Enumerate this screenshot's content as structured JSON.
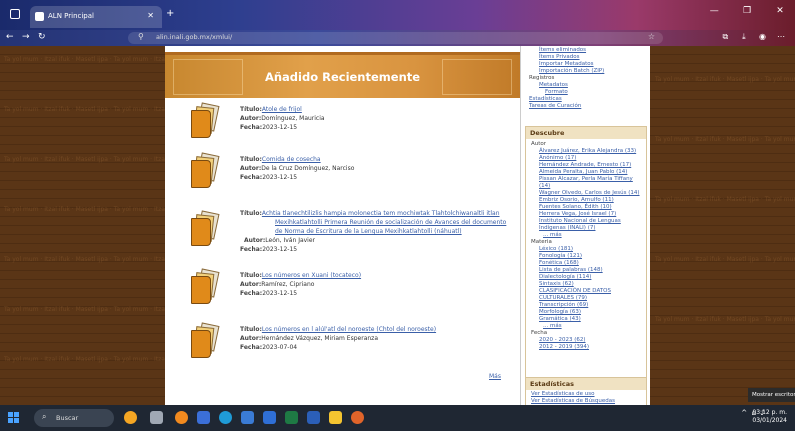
{
  "browser": {
    "tab_title": "ALN Principal",
    "tab_close": "✕",
    "new_tab": "+",
    "url": "alin.inali.gob.mx/xmlui/",
    "window": {
      "minimize": "—",
      "restore": "❐",
      "close": "✕"
    }
  },
  "page": {
    "banner_title": "Añadido Recientemente",
    "labels": {
      "title": "Título:",
      "author": "Autor:",
      "date": "Fecha:"
    },
    "records": [
      {
        "title": "Atole de frijol",
        "author": "Domínguez, Mauricia",
        "date": "2023-12-15"
      },
      {
        "title": "Comida de cosecha",
        "author": "De la Cruz Domínguez, Narciso",
        "date": "2023-12-15"
      },
      {
        "title_lines": [
          "Achtia tlanechtilizlis hampia molonectia tem mochiwtak Tlahtolchiwanaltli itlan",
          "Mexihkatlahtolli Primera Reunión de socialización de Avances del documento",
          "de Norma de Escritura de la Lengua Mexihkatlahtolli (náhuatl)"
        ],
        "author": "León, Iván Javier",
        "date": "2023-12-15"
      },
      {
        "title": "Los números en Xuani (tocateco)",
        "author": "Ramírez, Cipriano",
        "date": "2023-12-15"
      },
      {
        "title": "Los números en l alúl'atl del noroeste (Chtol del noroeste)",
        "author": "Hernández Vázquez, Miriam Esperanza",
        "date": "2023-07-04"
      }
    ],
    "more_link": "Más"
  },
  "sidebar": {
    "admin_links": [
      "Ítems eliminados",
      "Ítems Privados",
      "Importar Metadatos",
      "Importación Batch (ZIP)"
    ],
    "registros_label": "Registros",
    "registros_links": [
      "Metadatos",
      "Formato"
    ],
    "other_links": [
      "Estadísticas",
      "Tareas de Curación"
    ],
    "descubre": {
      "title": "Descubre",
      "autor_label": "Autor",
      "autor_items": [
        "Álvarez Juárez, Erika Alejandra (33)",
        "Anónimo (17)",
        "Hernández Andrade, Ernesto (17)",
        "Almeida Peralta, Juan Pablo (14)",
        "Pissan Alcazar, Perla María Tiffany",
        "(14)",
        "Wagner Olvedo, Carlos de Jesús (14)",
        "Embriz Osorio, Arnulfo (11)",
        "Fuentes Solano, Édith (10)",
        "Herrera Vega, José Israel (7)",
        "Instituto Nacional de Lenguas",
        "Indígenas (INALI) (7)",
        "... más"
      ],
      "materia_label": "Materia",
      "materia_items": [
        "Léxico (181)",
        "Fonología (121)",
        "Fonética (168)",
        "Lista de palabras (148)",
        "Dialectología (114)",
        "Sintaxis (62)",
        "CLASIFICACIÓN DE DATOS",
        "CULTURALES (79)",
        "Transcripción (69)",
        "Morfología (63)",
        "Gramática (43)",
        "... más"
      ],
      "fecha_label": "Fecha",
      "fecha_items": [
        "2020 - 2023 (62)",
        "2012 - 2019 (394)"
      ]
    },
    "estadisticas": {
      "title": "Estadísticas",
      "links": [
        "Ver Estadísticas de uso",
        "Ver Estadísticas de Búsquedas"
      ]
    }
  },
  "taskbar": {
    "search_placeholder": "Buscar",
    "time": "03:12 p. m.",
    "date": "03/01/2024",
    "toast": "Mostrar escritorio"
  },
  "background_text": [
    "Ta yol mum · Itzal ifuk · Masetl ijpa · Ta yol mum · Itzal ifuk · Masetl ijpa"
  ]
}
